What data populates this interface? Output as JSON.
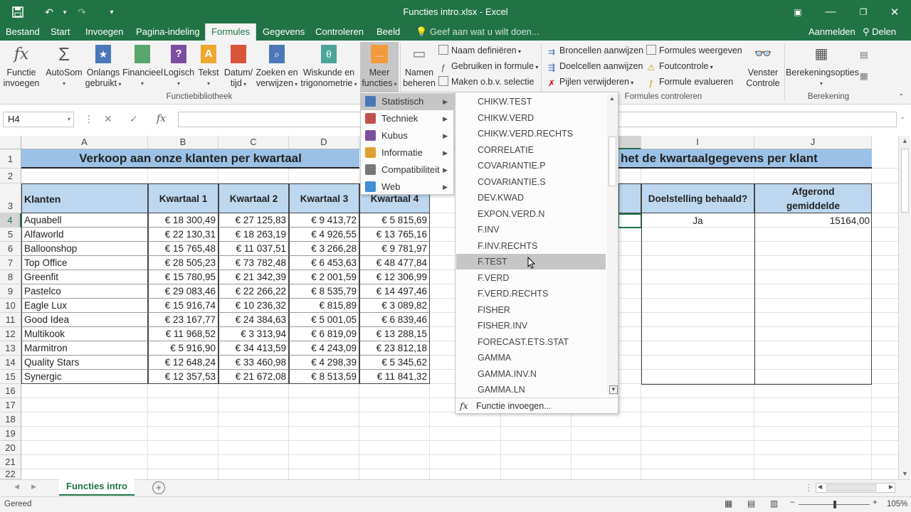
{
  "window": {
    "title": "Functies intro.xlsx - Excel"
  },
  "tabs": [
    {
      "label": "Bestand"
    },
    {
      "label": "Start"
    },
    {
      "label": "Invoegen"
    },
    {
      "label": "Pagina-indeling"
    },
    {
      "label": "Formules",
      "active": true
    },
    {
      "label": "Gegevens"
    },
    {
      "label": "Controleren"
    },
    {
      "label": "Beeld"
    }
  ],
  "tell_me": "Geef aan wat u wilt doen...",
  "user": {
    "signin": "Aanmelden",
    "share": "Delen"
  },
  "ribbon": {
    "functiebibliotheek": {
      "label": "Functiebibliotheek",
      "buttons": [
        {
          "line1": "Functie",
          "line2": "invoegen"
        },
        {
          "line1": "AutoSom",
          "line2": ""
        },
        {
          "line1": "Onlangs",
          "line2": "gebruikt"
        },
        {
          "line1": "Financieel",
          "line2": ""
        },
        {
          "line1": "Logisch",
          "line2": ""
        },
        {
          "line1": "Tekst",
          "line2": ""
        },
        {
          "line1": "Datum/",
          "line2": "tijd"
        },
        {
          "line1": "Zoeken en",
          "line2": "verwijzen"
        },
        {
          "line1": "Wiskunde en",
          "line2": "trigonometrie"
        },
        {
          "line1": "Meer",
          "line2": "functies"
        }
      ]
    },
    "namen": {
      "beheren": {
        "line1": "Namen",
        "line2": "beheren"
      },
      "definieren": "Naam definiëren",
      "gebruiken": "Gebruiken in formule",
      "maken": "Maken o.b.v. selectie"
    },
    "controleren": {
      "label": "Formules controleren",
      "items": [
        "Broncellen aanwijzen",
        "Doelcellen aanwijzen",
        "Pijlen verwijderen",
        "Formules weergeven",
        "Foutcontrole",
        "Formule evalueren"
      ],
      "venster": {
        "line1": "Venster",
        "line2": "Controle"
      }
    },
    "berekening": {
      "label": "Berekening",
      "opties": "Berekeningsopties"
    }
  },
  "formula_bar": {
    "name_box": "H4",
    "formula": ""
  },
  "columns": [
    "A",
    "B",
    "C",
    "D",
    "E",
    "F",
    "G",
    "H",
    "I",
    "J"
  ],
  "rows": [
    "1",
    "2",
    "3",
    "4",
    "5",
    "6",
    "7",
    "8",
    "9",
    "10",
    "11",
    "12",
    "13",
    "14",
    "15",
    "16",
    "17",
    "18",
    "19",
    "20",
    "21",
    "22"
  ],
  "sheet": {
    "title_left": "Verkoop aan onze klanten per kwartaal",
    "title_right": "het de kwartaalgegevens per klant",
    "headers": [
      "Klanten",
      "Kwartaal 1",
      "Kwartaal 2",
      "Kwartaal 3",
      "Kwartaal 4"
    ],
    "header_doel": "Doelstelling behaald?",
    "header_afgerond_1": "Afgerond",
    "header_afgerond_2": "gemiddelde",
    "row4_doel": "Ja",
    "row4_afgerond": "15164,00",
    "data": [
      [
        "Aquabell",
        "€ 18 300,49",
        "€ 27 125,83",
        "€ 9 413,72",
        "€ 5 815,69"
      ],
      [
        "Alfaworld",
        "€ 22 130,31",
        "€ 18 263,19",
        "€ 4 926,55",
        "€ 13 765,16"
      ],
      [
        "Balloonshop",
        "€ 15 765,48",
        "€ 11 037,51",
        "€ 3 266,28",
        "€ 9 781,97"
      ],
      [
        "Top Office",
        "€ 28 505,23",
        "€ 73 782,48",
        "€ 6 453,63",
        "€ 48 477,84"
      ],
      [
        "Greenfit",
        "€ 15 780,95",
        "€ 21 342,39",
        "€ 2 001,59",
        "€ 12 306,99"
      ],
      [
        "Pastelco",
        "€ 29 083,46",
        "€ 22 266,22",
        "€ 8 535,79",
        "€ 14 497,46"
      ],
      [
        "Eagle Lux",
        "€ 15 916,74",
        "€ 10 236,32",
        "€ 815,89",
        "€ 3 089,82"
      ],
      [
        "Good Idea",
        "€ 23 167,77",
        "€ 24 384,63",
        "€ 5 001,05",
        "€ 6 839,46"
      ],
      [
        "Multikook",
        "€ 11 968,52",
        "€ 3 313,94",
        "€ 6 819,09",
        "€ 13 288,15"
      ],
      [
        "Marmitron",
        "€ 5 916,90",
        "€ 34 413,59",
        "€ 4 243,09",
        "€ 23 812,18"
      ],
      [
        "Quality Stars",
        "€ 12 648,24",
        "€ 33 460,98",
        "€ 4 298,39",
        "€ 5 345,62"
      ],
      [
        "Synergic",
        "€ 12 357,53",
        "€ 21 672,08",
        "€ 8 513,59",
        "€ 11 841,32"
      ]
    ]
  },
  "menu_categories": [
    {
      "label": "Statistisch",
      "color": "#4a78b8"
    },
    {
      "label": "Techniek",
      "color": "#c0504d"
    },
    {
      "label": "Kubus",
      "color": "#7b4fa0"
    },
    {
      "label": "Informatie",
      "color": "#e0a030"
    },
    {
      "label": "Compatibiliteit",
      "color": "#777777"
    },
    {
      "label": "Web",
      "color": "#3f8fd2"
    }
  ],
  "function_list": [
    "CHIKW.TEST",
    "CHIKW.VERD",
    "CHIKW.VERD.RECHTS",
    "CORRELATIE",
    "COVARIANTIE.P",
    "COVARIANTIE.S",
    "DEV.KWAD",
    "EXPON.VERD.N",
    "F.INV",
    "F.INV.RECHTS",
    "F.TEST",
    "F.VERD",
    "F.VERD.RECHTS",
    "FISHER",
    "FISHER.INV",
    "FORECAST.ETS.STAT",
    "GAMMA",
    "GAMMA.INV.N",
    "GAMMA.LN"
  ],
  "function_hover_index": 10,
  "function_footer": "Functie invoegen...",
  "sheet_tab": "Functies intro",
  "status": {
    "ready": "Gereed",
    "zoom": "105%"
  },
  "colors": {
    "accent": "#217346",
    "header_fill": "#bdd7ee",
    "title_fill": "#9bc2e6"
  }
}
